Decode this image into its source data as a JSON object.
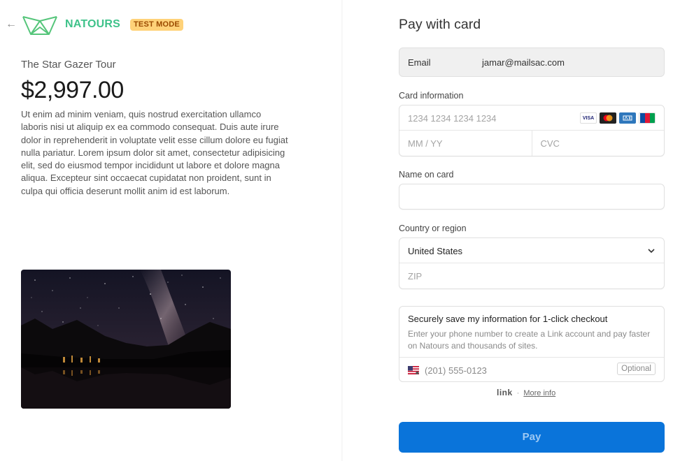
{
  "header": {
    "brand": "NATOURS",
    "badge": "TEST MODE",
    "back_icon": "arrow-left-icon",
    "logo_icon": "natours-mountain-logo"
  },
  "product": {
    "name": "The Star Gazer Tour",
    "price": "$2,997.00",
    "description": "Ut enim ad minim veniam, quis nostrud exercitation ullamco laboris nisi ut aliquip ex ea commodo consequat. Duis aute irure dolor in reprehenderit in voluptate velit esse cillum dolore eu fugiat nulla pariatur. Lorem ipsum dolor sit amet, consectetur adipisicing elit, sed do eiusmod tempor incididunt ut labore et dolore magna aliqua. Excepteur sint occaecat cupidatat non proident, sunt in culpa qui officia deserunt mollit anim id est laborum."
  },
  "form": {
    "title": "Pay with card",
    "email_label": "Email",
    "email_value": "jamar@mailsac.com",
    "card_label": "Card information",
    "card_number_placeholder": "1234 1234 1234 1234",
    "expiry_placeholder": "MM / YY",
    "cvc_placeholder": "CVC",
    "card_brands": [
      "VISA",
      "mastercard",
      "AMEX",
      "JCB"
    ],
    "name_label": "Name on card",
    "name_value": "",
    "country_label": "Country or region",
    "country_value": "United States",
    "zip_placeholder": "ZIP"
  },
  "link": {
    "title": "Securely save my information for 1-click checkout",
    "subtitle": "Enter your phone number to create a Link account and pay faster on Natours and thousands of sites.",
    "phone_placeholder": "(201) 555-0123",
    "optional": "Optional",
    "footer_logo": "link",
    "footer_sep": "·",
    "more_info": "More info"
  },
  "pay_button": "Pay",
  "colors": {
    "brand_green": "#3fc28a",
    "badge_bg": "#ffd279",
    "pay_blue": "#0a74da"
  }
}
